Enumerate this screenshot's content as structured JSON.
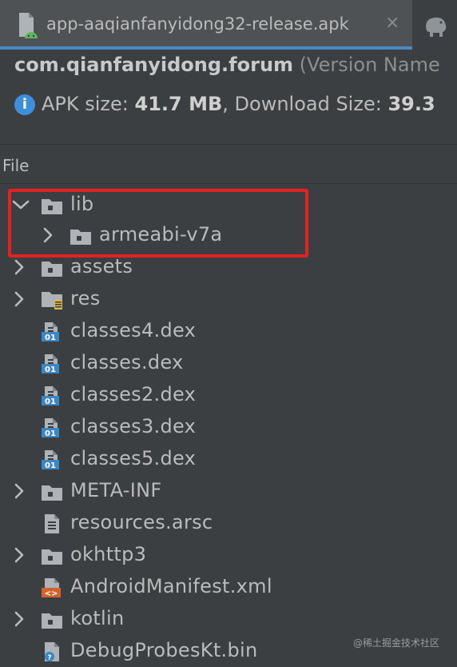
{
  "tab": {
    "label": "app-aaqianfanyidong32-release.apk",
    "close": "×"
  },
  "header": {
    "package": "com.qianfanyidong.forum",
    "version_prefix": "(Version Name",
    "size_label": "APK size: ",
    "size_value": "41.7 MB",
    "download_label": ", Download Size: ",
    "download_value": "39.3"
  },
  "column": {
    "file": "File"
  },
  "tree": {
    "lib": "lib",
    "armeabi": "armeabi-v7a",
    "assets": "assets",
    "res": "res",
    "classes4": "classes4.dex",
    "classes": "classes.dex",
    "classes2": "classes2.dex",
    "classes3": "classes3.dex",
    "classes5": "classes5.dex",
    "metainf": "META-INF",
    "resources": "resources.arsc",
    "okhttp3": "okhttp3",
    "manifest": "AndroidManifest.xml",
    "kotlin": "kotlin",
    "debugprobes": "DebugProbesKt.bin"
  },
  "dex_badge": "01",
  "xml_badge": "<>",
  "watermark": "@稀土掘金技术社区",
  "colors": {
    "accent": "#4a88c7",
    "highlight": "#e52222",
    "dex": "#3b87c6",
    "xml": "#d0642c"
  }
}
